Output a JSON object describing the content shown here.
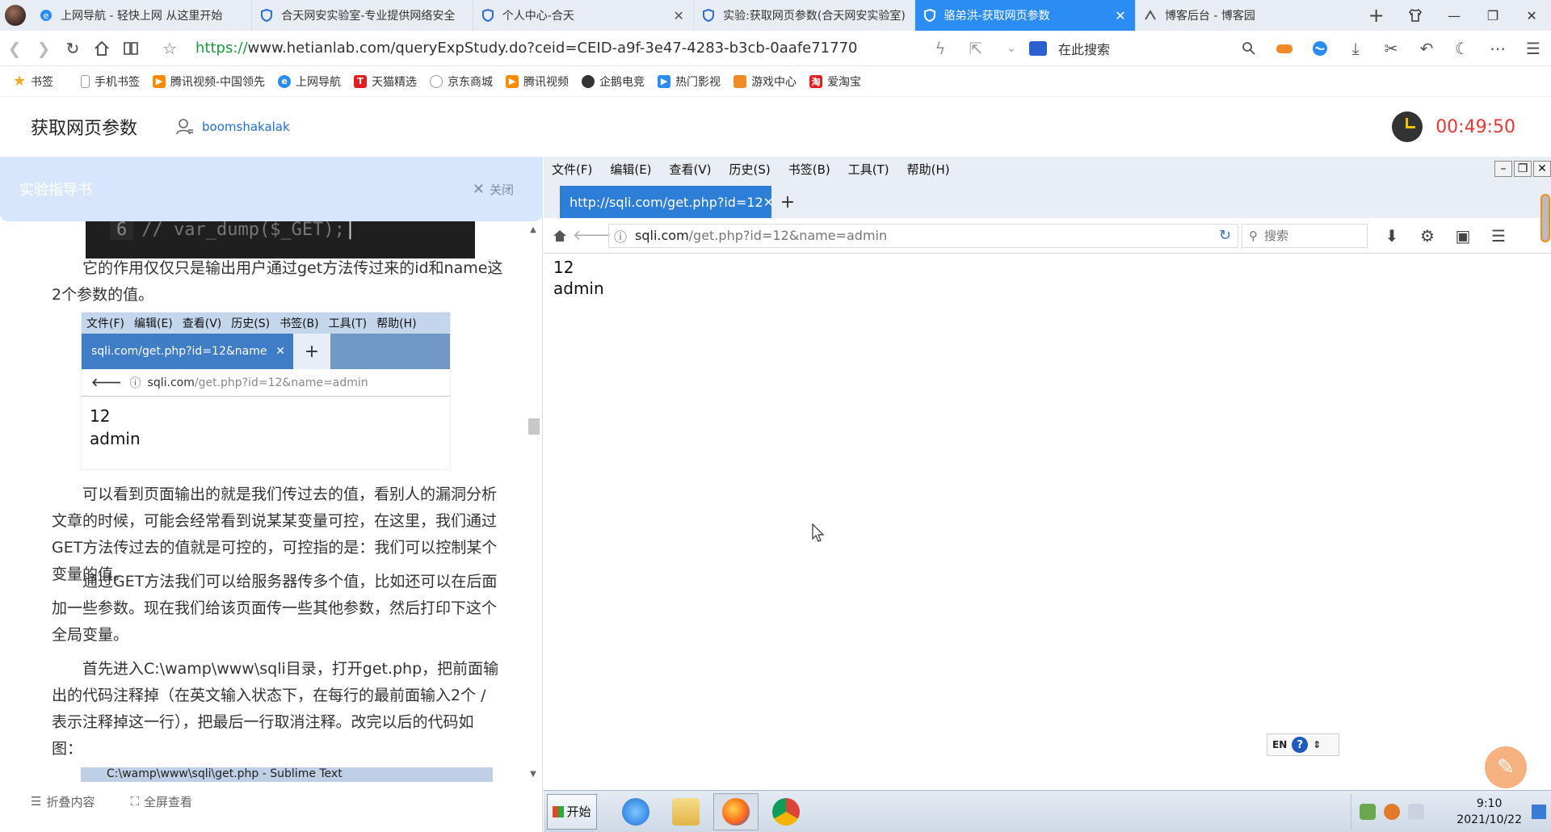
{
  "browser": {
    "tabs": [
      {
        "title": "上网导航 - 轻快上网 从这里开始",
        "icon": "e-icon",
        "active": false
      },
      {
        "title": "合天网安实验室-专业提供网络安全",
        "icon": "shield-icon",
        "active": false
      },
      {
        "title": "个人中心-合天",
        "icon": "shield-icon",
        "active": false
      },
      {
        "title": "实验:获取网页参数(合天网安实验室)",
        "icon": "shield-icon",
        "active": false
      },
      {
        "title": "骆弟洪-获取网页参数",
        "icon": "shield-icon",
        "active": true
      },
      {
        "title": "博客后台 - 博客园",
        "icon": "blog-icon",
        "active": false
      }
    ],
    "url_scheme": "https://",
    "url_rest": "www.hetianlab.com/queryExpStudy.do?ceid=CEID-a9f-3e47-4283-b3cb-0aafe7177071",
    "search_placeholder": "在此搜索",
    "accent_color": "#2b8cf3"
  },
  "bookmarks": [
    {
      "label": "书签",
      "icon": "star-icon",
      "color": "#f5a623"
    },
    {
      "label": "手机书签",
      "icon": "phone-icon",
      "color": "#999999"
    },
    {
      "label": "腾讯视频-中国领先",
      "icon": "play-icon",
      "color": "#ff8a00"
    },
    {
      "label": "上网导航",
      "icon": "e-icon",
      "color": "#2b8cf3"
    },
    {
      "label": "天猫精选",
      "icon": "tmall-icon",
      "color": "#e02020"
    },
    {
      "label": "京东商城",
      "icon": "globe-icon",
      "color": "#999999"
    },
    {
      "label": "腾讯视频",
      "icon": "play-icon",
      "color": "#ff8a00"
    },
    {
      "label": "企鹅电竞",
      "icon": "penguin-icon",
      "color": "#333333"
    },
    {
      "label": "热门影视",
      "icon": "film-icon",
      "color": "#2b8cf3"
    },
    {
      "label": "游戏中心",
      "icon": "game-icon",
      "color": "#f08a24"
    },
    {
      "label": "爱淘宝",
      "icon": "taobao-icon",
      "color": "#e02020"
    }
  ],
  "page": {
    "title": "获取网页参数",
    "username": "boomshakalak",
    "timer": "00:49:50"
  },
  "guide": {
    "header": "实验指导书",
    "close_label": "关闭",
    "code_line_no": "6",
    "code_text": "// var_dump($_GET);",
    "para1": "它的作用仅仅只是输出用户通过get方法传过来的id和name这2个参数的值。",
    "shot": {
      "menu": [
        "文件(F)",
        "编辑(E)",
        "查看(V)",
        "历史(S)",
        "书签(B)",
        "工具(T)",
        "帮助(H)"
      ],
      "tab_title": "sqli.com/get.php?id=12&name",
      "addr_host": "sqli.com",
      "addr_path": "/get.php?id=12&name=admin",
      "out1": "12",
      "out2": "admin"
    },
    "para2": "可以看到页面输出的就是我们传过去的值，看别人的漏洞分析文章的时候，可能会经常看到说某某变量可控，在这里，我们通过GET方法传过去的值就是可控的，可控指的是：我们可以控制某个变量的值。",
    "para3": "通过GET方法我们可以给服务器传多个值，比如还可以在后面加一些参数。现在我们给该页面传一些其他参数，然后打印下这个全局变量。",
    "para4": "首先进入C:\\wamp\\www\\sqli目录，打开get.php，把前面输出的代码注释掉（在英文输入状态下，在每行的最前面输入2个 / 表示注释掉这一行），把最后一行取消注释。改完以后的代码如图：",
    "shot2_title": "C:\\wamp\\www\\sqli\\get.php - Sublime Text",
    "footer_collapse": "折叠内容",
    "footer_fullscreen": "全屏查看"
  },
  "remote": {
    "menu": [
      "文件(F)",
      "编辑(E)",
      "查看(V)",
      "历史(S)",
      "书签(B)",
      "工具(T)",
      "帮助(H)"
    ],
    "tab_title": "http://sqli.com/get.php?id=12",
    "addr_host": "sqli.com",
    "addr_path": "/get.php?id=12&name=admin",
    "search_placeholder": "搜索",
    "output": [
      "12",
      "admin"
    ],
    "ime_lang": "EN",
    "taskbar": {
      "start_label": "开始",
      "time": "9:10",
      "date": "2021/10/22"
    }
  }
}
